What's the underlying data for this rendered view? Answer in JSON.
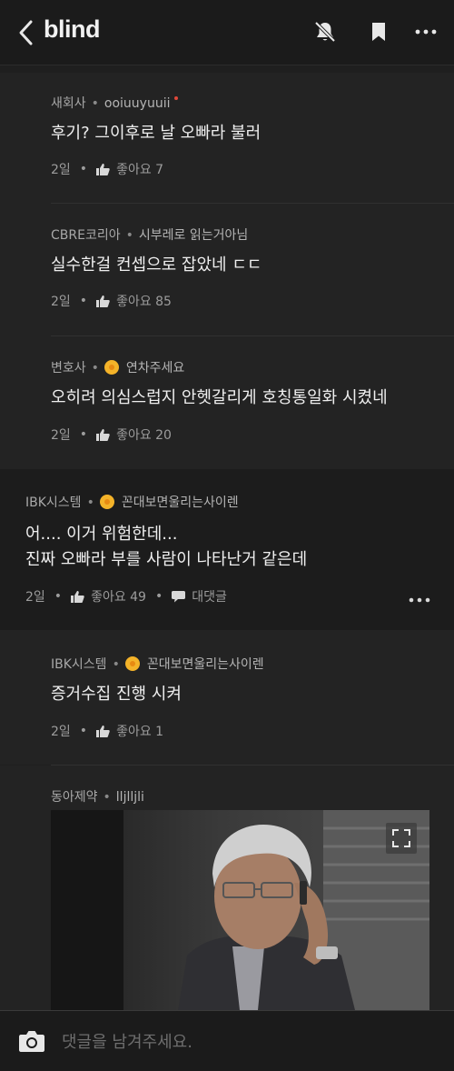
{
  "header": {
    "logo": "blind",
    "icons": [
      "back-icon",
      "notification-off-icon",
      "bookmark-icon",
      "more-icon"
    ]
  },
  "comments": [
    {
      "company": "새회사",
      "nickname": "ooiuuyuuii",
      "new_dot": true,
      "text": [
        "후기? 그이후로 날 오빠라 불러"
      ],
      "time": "2일",
      "likes": "좋아요 7"
    },
    {
      "company": "CBRE코리아",
      "nickname": "시부레로 읽는거아님",
      "text": [
        "실수한걸 컨셉으로 잡았네 ㄷㄷ"
      ],
      "time": "2일",
      "likes": "좋아요 85"
    },
    {
      "company": "변호사",
      "nickname": "연차주세요",
      "badge": true,
      "text": [
        "오히려 의심스럽지 안헷갈리게 호칭통일화 시켰네"
      ],
      "time": "2일",
      "likes": "좋아요 20"
    },
    {
      "company": "IBK시스템",
      "nickname": "꼰대보면울리는사이렌",
      "badge": true,
      "text": [
        "어.... 이거 위험한데...",
        "진짜 오빠라 부를 사람이 나타난거 같은데"
      ],
      "time": "2일",
      "likes": "좋아요 49",
      "reply_label": "대댓글"
    },
    {
      "company": "IBK시스템",
      "nickname": "꼰대보면울리는사이렌",
      "badge": true,
      "text": [
        "증거수집 진행 시켜"
      ],
      "time": "2일",
      "likes": "좋아요 1"
    },
    {
      "company": "동아제약",
      "nickname": "lljlljli",
      "image": "photo-man-on-phone"
    }
  ],
  "input": {
    "placeholder": "댓글을 남겨주세요."
  },
  "colors": {
    "background": "#1f1f1f",
    "reply_background": "#232323",
    "text": "#efefef",
    "muted": "#9c9c9c",
    "badge": "#f4b329",
    "new_dot": "#e0483a"
  }
}
